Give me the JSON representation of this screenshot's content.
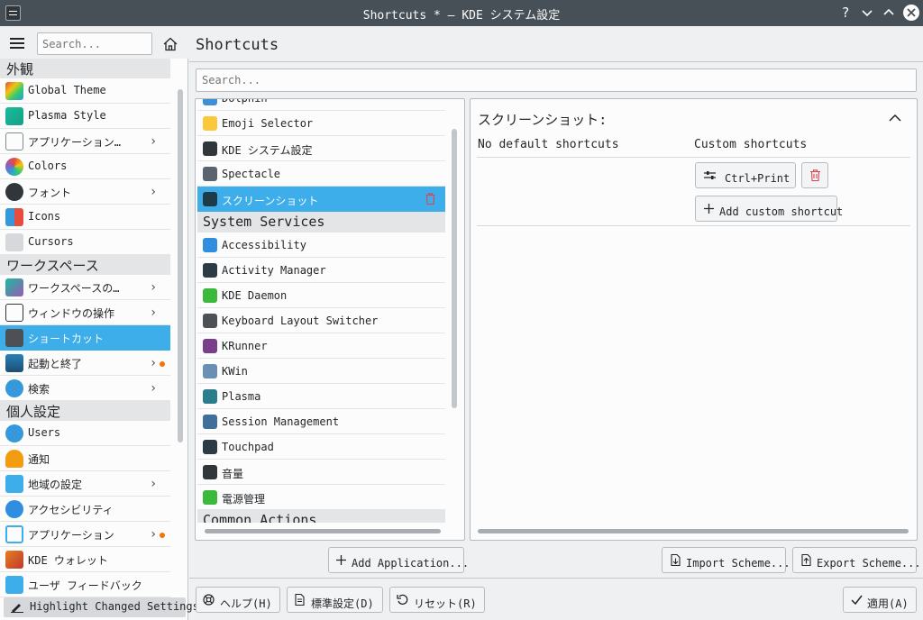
{
  "window": {
    "title": "Shortcuts * — KDE システム設定"
  },
  "sidebar": {
    "search_placeholder": "Search...",
    "groups": [
      {
        "label": "外観",
        "items": [
          {
            "label": "Global Theme",
            "icon": "global-theme-icon"
          },
          {
            "label": "Plasma Style",
            "icon": "plasma-style-icon"
          },
          {
            "label": "アプリケーション…",
            "icon": "application-style-icon",
            "chevron": true
          },
          {
            "label": "Colors",
            "icon": "colors-icon"
          },
          {
            "label": "フォント",
            "icon": "fonts-icon",
            "chevron": true
          },
          {
            "label": "Icons",
            "icon": "icons-icon"
          },
          {
            "label": "Cursors",
            "icon": "cursors-icon"
          }
        ]
      },
      {
        "label": "ワークスペース",
        "items": [
          {
            "label": "ワークスペースの…",
            "icon": "workspace-behavior-icon",
            "chevron": true
          },
          {
            "label": "ウィンドウの操作",
            "icon": "window-management-icon",
            "chevron": true
          },
          {
            "label": "ショートカット",
            "icon": "keyboard-icon",
            "selected": true
          },
          {
            "label": "起動と終了",
            "icon": "startup-shutdown-icon",
            "chevron": true,
            "changed": true
          },
          {
            "label": "検索",
            "icon": "search-icon",
            "chevron": true
          }
        ]
      },
      {
        "label": "個人設定",
        "items": [
          {
            "label": "Users",
            "icon": "users-icon"
          },
          {
            "label": "通知",
            "icon": "notifications-icon"
          },
          {
            "label": "地域の設定",
            "icon": "regional-settings-icon",
            "chevron": true
          },
          {
            "label": "アクセシビリティ",
            "icon": "accessibility-icon"
          },
          {
            "label": "アプリケーション",
            "icon": "applications-icon",
            "chevron": true,
            "changed": true
          },
          {
            "label": "KDE ウォレット",
            "icon": "kwallet-icon"
          },
          {
            "label": "ユーザ フィードバック",
            "icon": "feedback-icon"
          }
        ]
      }
    ],
    "highlight_label": "Highlight Changed Settings"
  },
  "main": {
    "title": "Shortcuts",
    "search_placeholder": "Search...",
    "components": {
      "rows": [
        {
          "label": "Dolphin",
          "type": "item",
          "icon": "dolphin-icon",
          "color": "#3d8fd8"
        },
        {
          "label": "Emoji Selector",
          "type": "item",
          "icon": "emoji-icon",
          "color": "#fbc73c"
        },
        {
          "label": "KDE システム設定",
          "type": "item",
          "icon": "system-settings-icon",
          "color": "#31363b"
        },
        {
          "label": "Spectacle",
          "type": "item",
          "icon": "spectacle-icon",
          "color": "#5a6470"
        },
        {
          "label": "スクリーンショット",
          "type": "item",
          "icon": "screenshot-icon",
          "color": "#1f3b48",
          "selected": true
        },
        {
          "label": "System Services",
          "type": "category"
        },
        {
          "label": "Accessibility",
          "type": "item",
          "icon": "accessibility-icon",
          "color": "#2f8ee0"
        },
        {
          "label": "Activity Manager",
          "type": "item",
          "icon": "activity-manager-icon",
          "color": "#2c3a48"
        },
        {
          "label": "KDE Daemon",
          "type": "item",
          "icon": "kde-daemon-icon",
          "color": "#3cb83c"
        },
        {
          "label": "Keyboard Layout Switcher",
          "type": "item",
          "icon": "keyboard-layout-icon",
          "color": "#4d5156"
        },
        {
          "label": "KRunner",
          "type": "item",
          "icon": "krunner-icon",
          "color": "#7a3f8a"
        },
        {
          "label": "KWin",
          "type": "item",
          "icon": "kwin-icon",
          "color": "#6a8fb5"
        },
        {
          "label": "Plasma",
          "type": "item",
          "icon": "plasma-icon",
          "color": "#2a7d8c"
        },
        {
          "label": "Session Management",
          "type": "item",
          "icon": "session-management-icon",
          "color": "#3f6f9a"
        },
        {
          "label": "Touchpad",
          "type": "item",
          "icon": "touchpad-icon",
          "color": "#2c3a48"
        },
        {
          "label": "音量",
          "type": "item",
          "icon": "volume-icon",
          "color": "#31363b"
        },
        {
          "label": "電源管理",
          "type": "item",
          "icon": "power-management-icon",
          "color": "#3cb83c"
        },
        {
          "label": "Common Actions",
          "type": "category"
        }
      ]
    },
    "shortcut_panel": {
      "title": "スクリーンショット:",
      "col_default": "No default shortcuts",
      "col_custom": "Custom shortcuts",
      "key_label": "Ctrl+Print",
      "add_custom_label": "Add custom shortcut"
    },
    "add_application_label": "Add Application...",
    "import_label": "Import Scheme...",
    "export_label": "Export Scheme..."
  },
  "footer": {
    "help_label": "ヘルプ(H)",
    "defaults_label": "標準設定(D)",
    "reset_label": "リセット(R)",
    "apply_label": "適用(A)"
  },
  "colors": {
    "accent": "#3daee9",
    "changed_dot": "#f67400",
    "delete": "#da4453"
  }
}
